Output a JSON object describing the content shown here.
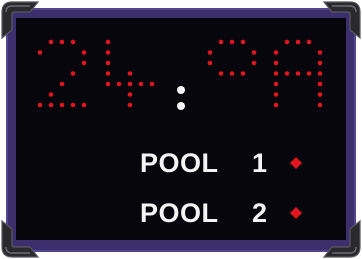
{
  "display": {
    "digits": [
      "2",
      "4",
      "0",
      "A"
    ],
    "separator": ":"
  },
  "pools": [
    {
      "label": "POOL",
      "number": "1"
    },
    {
      "label": "POOL",
      "number": "2"
    }
  ],
  "colors": {
    "frame": "#3b2f6e",
    "screen": "#07060c",
    "led": "#e0161e",
    "text": "#f4f4f4"
  }
}
